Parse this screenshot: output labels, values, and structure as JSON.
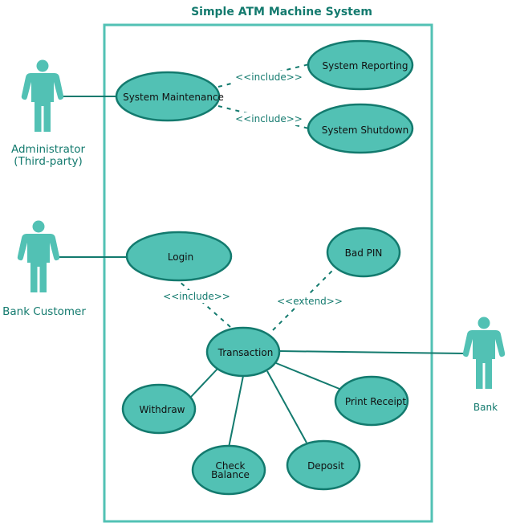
{
  "title": "Simple ATM Machine System",
  "colors": {
    "fill": "#52c1b4",
    "stroke": "#137a6e",
    "boundary": "#52c1b4",
    "text": "#111111",
    "label": "#137a6e"
  },
  "actors": [
    {
      "id": "administrator",
      "lines": [
        "Administrator",
        "(Third-party)"
      ]
    },
    {
      "id": "bank-customer",
      "lines": [
        "Bank Customer"
      ]
    },
    {
      "id": "bank",
      "lines": [
        "Bank"
      ]
    }
  ],
  "use_cases": [
    {
      "id": "system-maintenance",
      "lines": [
        "System Maintenance"
      ]
    },
    {
      "id": "system-reporting",
      "lines": [
        "System Reporting"
      ]
    },
    {
      "id": "system-shutdown",
      "lines": [
        "System Shutdown"
      ]
    },
    {
      "id": "login",
      "lines": [
        "Login"
      ]
    },
    {
      "id": "bad-pin",
      "lines": [
        "Bad PIN"
      ]
    },
    {
      "id": "transaction",
      "lines": [
        "Transaction"
      ]
    },
    {
      "id": "withdraw",
      "lines": [
        "Withdraw"
      ]
    },
    {
      "id": "check-balance",
      "lines": [
        "Check",
        "Balance"
      ]
    },
    {
      "id": "deposit",
      "lines": [
        "Deposit"
      ]
    },
    {
      "id": "print-receipt",
      "lines": [
        "Print Receipt"
      ]
    }
  ],
  "relationships": [
    {
      "from": "administrator",
      "to": "system-maintenance",
      "type": "association",
      "label": ""
    },
    {
      "from": "system-maintenance",
      "to": "system-reporting",
      "type": "include",
      "label": "<<include>>"
    },
    {
      "from": "system-maintenance",
      "to": "system-shutdown",
      "type": "include",
      "label": "<<include>>"
    },
    {
      "from": "bank-customer",
      "to": "login",
      "type": "association",
      "label": ""
    },
    {
      "from": "transaction",
      "to": "login",
      "type": "include",
      "label": "<<include>>"
    },
    {
      "from": "bad-pin",
      "to": "transaction",
      "type": "extend",
      "label": "<<extend>>"
    },
    {
      "from": "transaction",
      "to": "bank",
      "type": "association",
      "label": ""
    },
    {
      "from": "transaction",
      "to": "withdraw",
      "type": "association",
      "label": ""
    },
    {
      "from": "transaction",
      "to": "check-balance",
      "type": "association",
      "label": ""
    },
    {
      "from": "transaction",
      "to": "deposit",
      "type": "association",
      "label": ""
    },
    {
      "from": "transaction",
      "to": "print-receipt",
      "type": "association",
      "label": ""
    }
  ]
}
